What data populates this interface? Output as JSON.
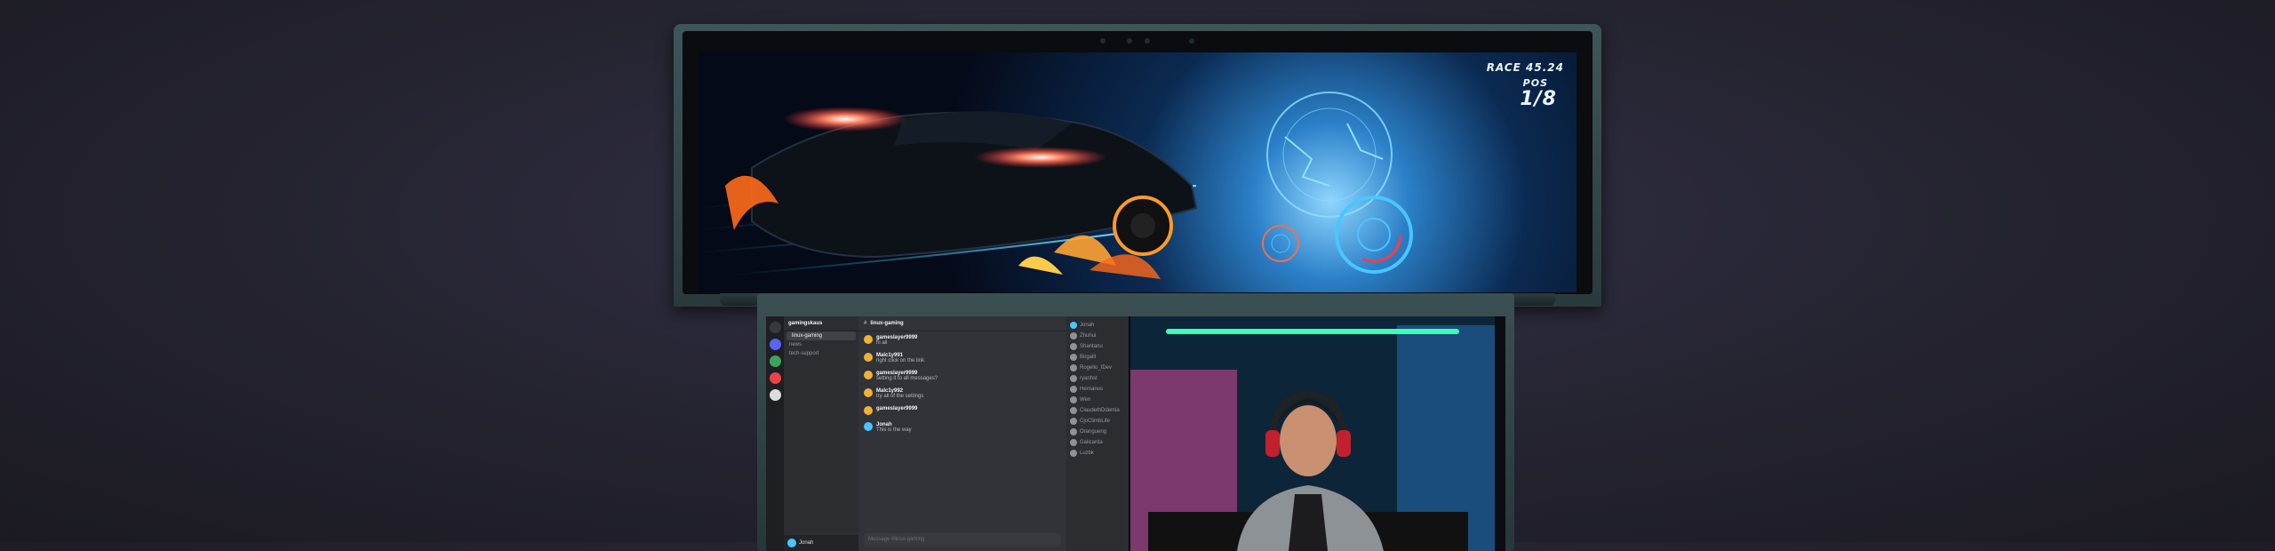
{
  "game": {
    "race_label": "RACE 45.24",
    "pos_label": "POS",
    "pos_value": "1/8"
  },
  "chat": {
    "server_name": "gamingskaus",
    "channel_title": "linux-gaming",
    "channel_topic": "",
    "channels": [
      {
        "label": "linux-gaming",
        "active": true
      },
      {
        "label": "news",
        "active": false
      },
      {
        "label": "tech-support",
        "active": false
      }
    ],
    "messages": [
      {
        "author": "gameslayer9999",
        "text": "hi all"
      },
      {
        "author": "Malc1y991",
        "text": "right click on the link"
      },
      {
        "author": "gameslayer9999",
        "text": "setting it to all messages?"
      },
      {
        "author": "Malc1y992",
        "text": "try all of the settings"
      },
      {
        "author": "gameslayer9999",
        "text": ""
      },
      {
        "author": "Jonah",
        "text": "This is the way"
      }
    ],
    "input_placeholder": "Message #linux-gaming",
    "user_name": "Jonah",
    "members": [
      "Jonah",
      "Zhuhui",
      "Shantanu",
      "Birgalll",
      "Rogelio_fDev",
      "ryanhst",
      "Hernanos",
      "Wen",
      "ClaudethDdemia",
      "CjoClimbLife",
      "Orangueng",
      "Galicarda",
      "Luzbk"
    ]
  },
  "colors": {
    "accent": "#5865f2",
    "neon_pink": "#ff3d9a",
    "neon_green": "#3dffb8",
    "car_orange": "#ff6a1a",
    "gauge_blue": "#49c6ff"
  }
}
